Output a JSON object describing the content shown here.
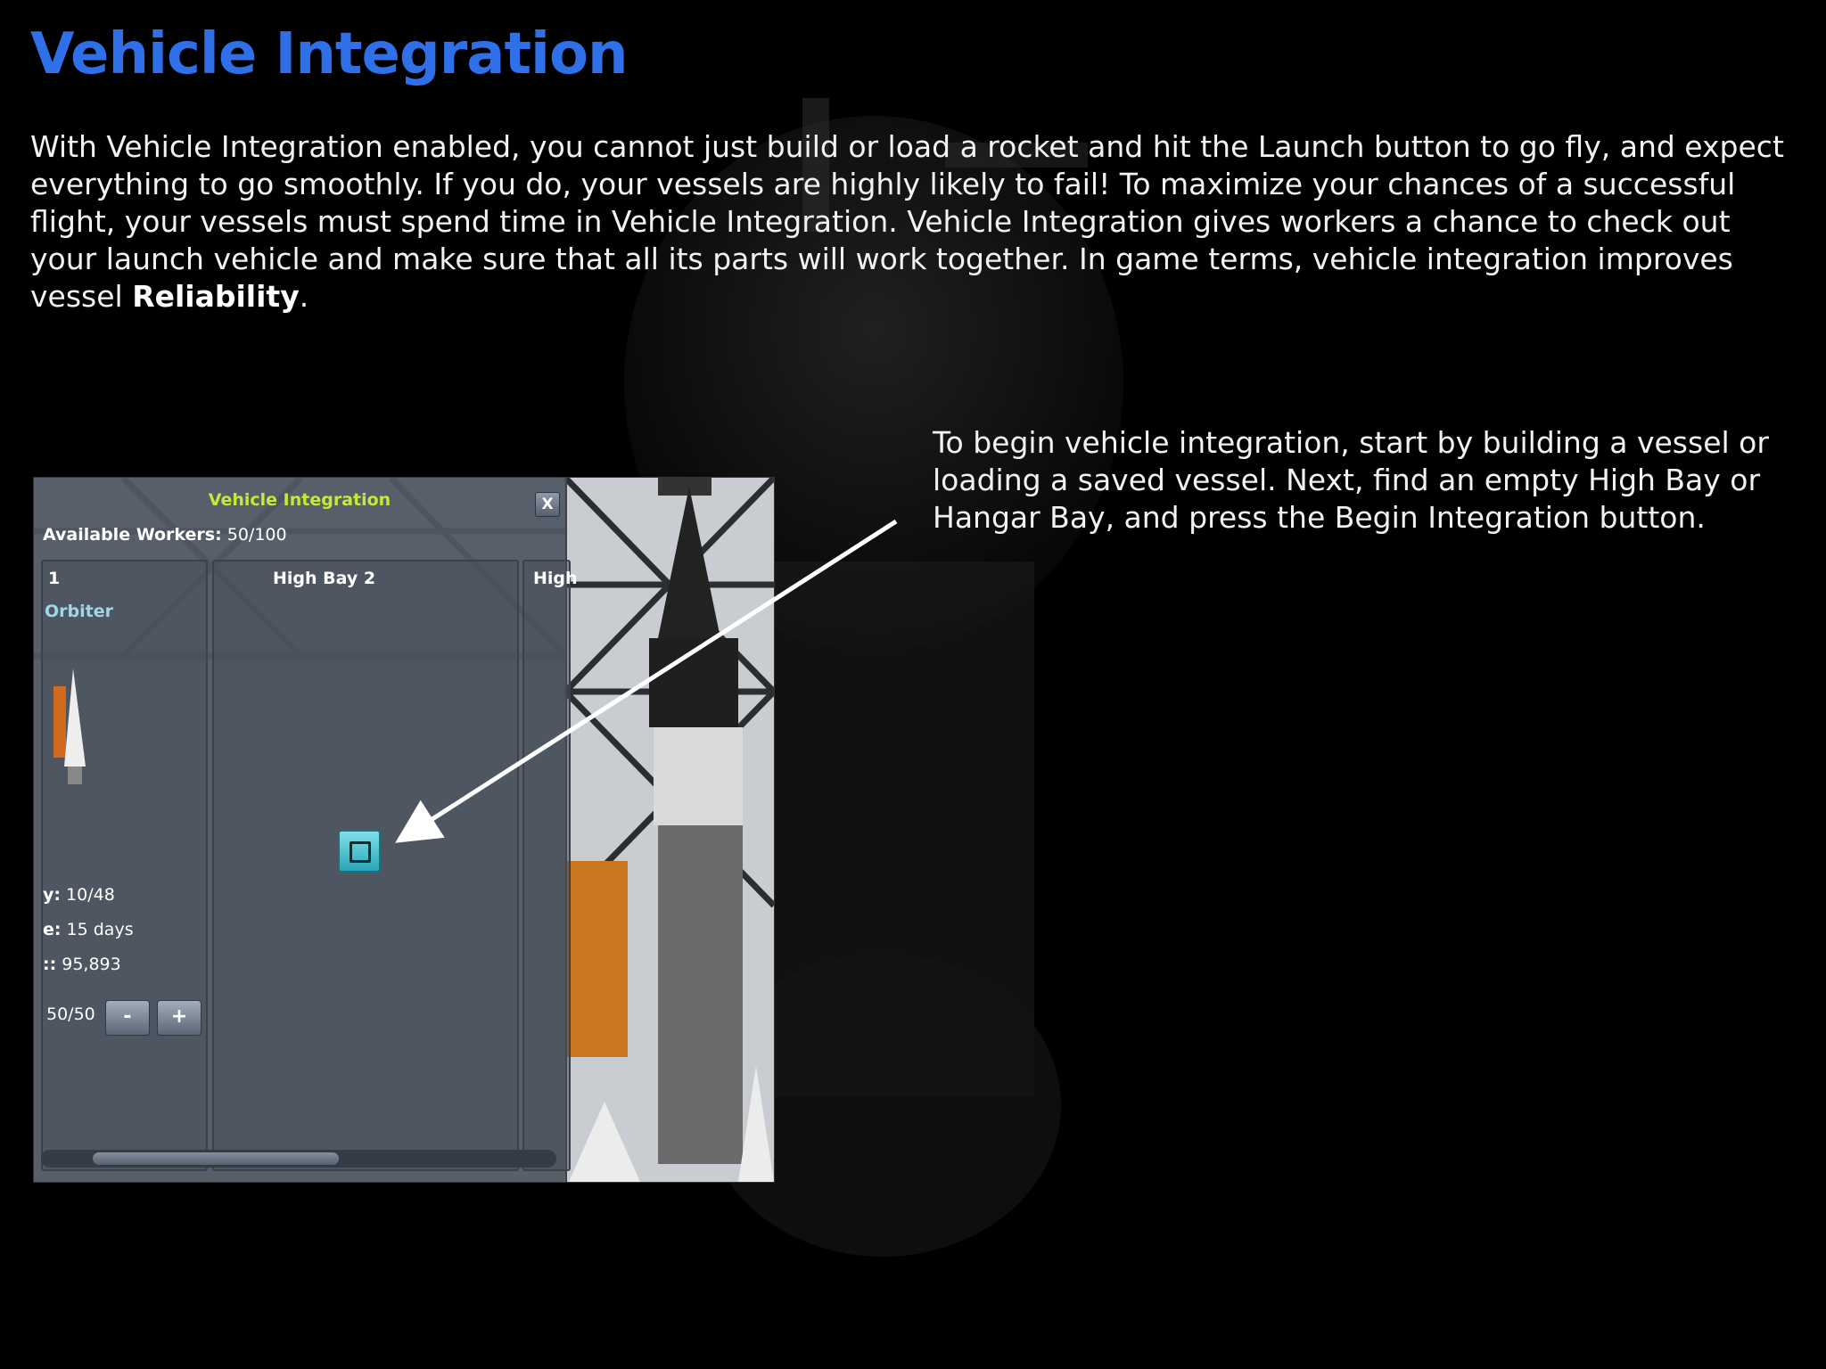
{
  "page": {
    "title": "Vehicle Integration",
    "intro_text": "With Vehicle Integration enabled, you cannot just build or load a rocket and hit the Launch button to go fly, and expect everything to go smoothly. If you do, your vessels are highly likely to fail! To maximize your chances of a successful flight, your vessels must spend time in Vehicle Integration. Vehicle Integration gives workers a chance to check out your launch vehicle and make sure that all its parts will work together. In game terms, vehicle integration improves vessel ",
    "intro_bold": "Reliability",
    "intro_end": ".",
    "callout_text": "To begin vehicle integration, start by building a vessel or loading a saved vessel. Next, find an empty High Bay or Hangar Bay, and press the Begin Integration button."
  },
  "colors": {
    "title": "#2f6fe8",
    "window_title": "#c6e83a",
    "vessel_name": "#9fd6e8",
    "begin_button": "#3fc0cf"
  },
  "game_window": {
    "title": "Vehicle Integration",
    "close_label": "X",
    "workers_label": "Available Workers:",
    "workers_value": "50/100",
    "bays": [
      {
        "title": "1",
        "vessel": "Orbiter",
        "stats": [
          {
            "label": "y:",
            "value": "10/48"
          },
          {
            "label": "e:",
            "value": "15 days"
          },
          {
            "label": "::",
            "value": "95,893"
          }
        ],
        "assigned": "50/50",
        "minus_label": "-",
        "plus_label": "+"
      },
      {
        "title": "High Bay  2",
        "begin_icon": "begin-integration-icon"
      },
      {
        "title": "High"
      }
    ]
  }
}
